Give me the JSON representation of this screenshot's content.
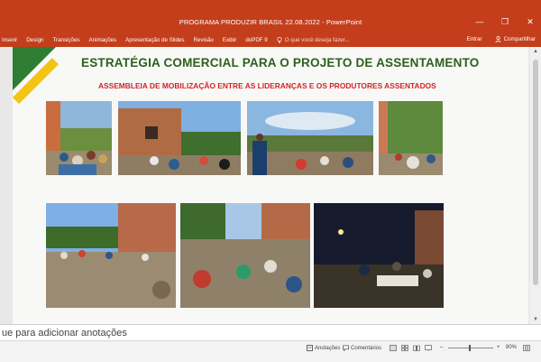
{
  "window": {
    "title": "PROGRAMA PRODUZIR BRASIL 22.08.2022 - PowerPoint",
    "minimize_icon": "minimize-icon",
    "restore_icon": "restore-icon",
    "close_icon": "close-icon"
  },
  "ribbon": {
    "tabs": [
      "Inserir",
      "Design",
      "Transições",
      "Animações",
      "Apresentação de Slides",
      "Revisão",
      "Exibir",
      "doPDF 9"
    ],
    "tell_me": "O que você deseja fazer...",
    "enter": "Entrar",
    "share": "Compartilhar"
  },
  "slide": {
    "title": "ESTRATÉGIA COMERCIAL PARA O PROJETO DE ASSENTAMENTO",
    "subtitle": "ASSEMBLEIA DE MOBILIZAÇÃO ENTRE AS LIDERANÇAS E OS PRODUTORES ASSENTADOS",
    "photos": [
      "meeting-photo-1",
      "meeting-photo-2",
      "meeting-photo-3",
      "meeting-photo-4",
      "meeting-photo-5",
      "meeting-photo-6",
      "meeting-photo-7",
      "meeting-photo-8"
    ],
    "colors": {
      "title": "#2e5e1f",
      "subtitle": "#d1232a",
      "corner_green": "#2f7d32",
      "corner_yellow": "#f2c414"
    }
  },
  "notes": {
    "placeholder": "ue para adicionar anotações"
  },
  "status": {
    "notes_label": "Anotações",
    "comments_label": "Comentários",
    "zoom": "80%"
  },
  "theme": {
    "accent": "#c43e1c"
  }
}
